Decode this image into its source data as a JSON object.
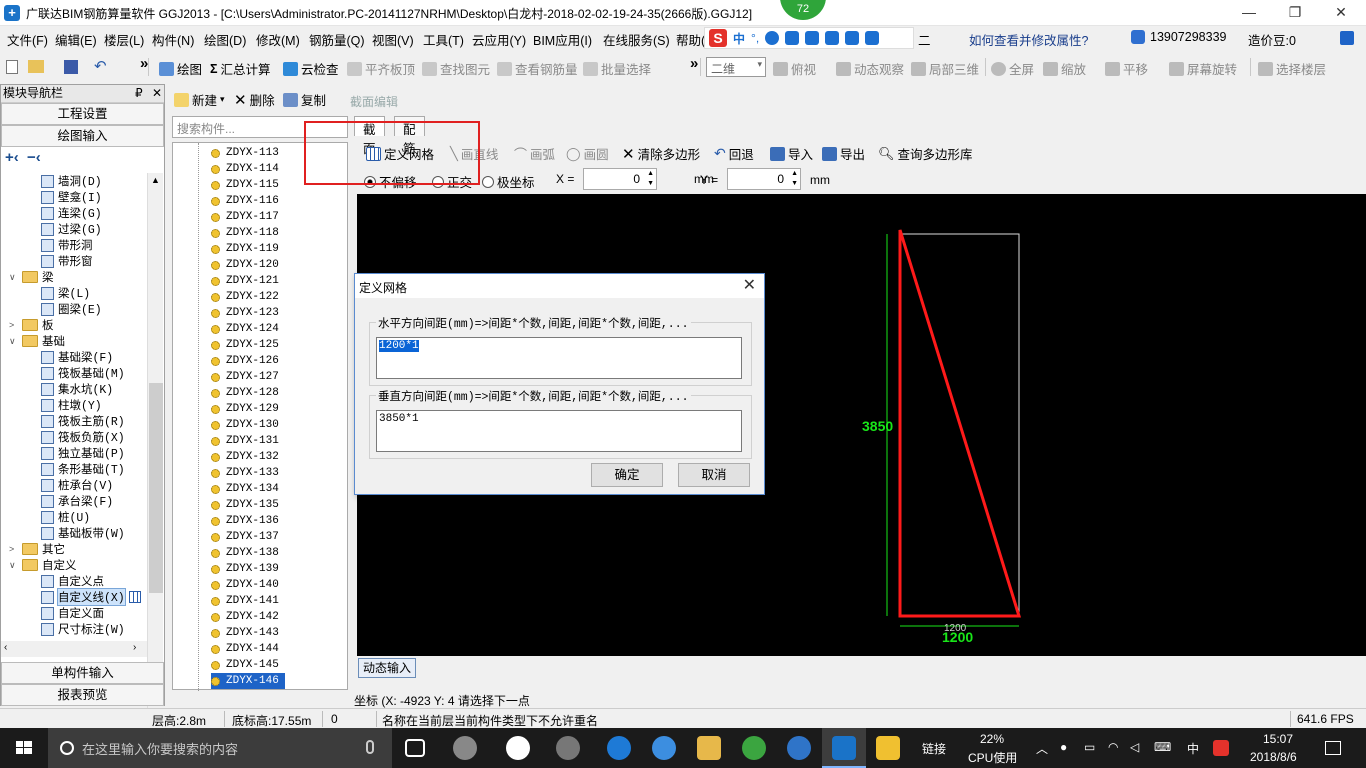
{
  "titlebar": {
    "title": "广联达BIM钢筋算量软件 GGJ2013 - [C:\\Users\\Administrator.PC-20141127NRHM\\Desktop\\白龙村-2018-02-02-19-24-35(2666版).GGJ12]",
    "update_badge": "72",
    "minimize": "—",
    "restore": "❐",
    "close": "✕"
  },
  "menu": {
    "items": [
      "文件(F)",
      "编辑(E)",
      "楼层(L)",
      "构件(N)",
      "绘图(D)",
      "修改(M)",
      "钢筋量(Q)",
      "视图(V)",
      "工具(T)",
      "云应用(Y)",
      "BIM应用(I)",
      "在线服务(S)",
      "帮助(H)"
    ],
    "ime_chars": [
      "中",
      "°,"
    ],
    "right_text": "二",
    "help_link": "如何查看并修改属性?",
    "phone": "13907298339",
    "beans": "造价豆:0"
  },
  "toolbar": {
    "items": [
      "绘图",
      "汇总计算",
      "云检查",
      "平齐板顶",
      "查找图元",
      "查看钢筋量",
      "批量选择"
    ],
    "view_mode": "二维",
    "view_items": [
      "俯视",
      "动态观察",
      "局部三维",
      "全屏",
      "缩放",
      "平移",
      "屏幕旋转",
      "选择楼层"
    ]
  },
  "nav": {
    "title": "模块导航栏",
    "pin": "₽",
    "close": "✕",
    "sections_top": [
      "工程设置",
      "绘图输入"
    ],
    "sections_bottom": [
      "单构件输入",
      "报表预览"
    ],
    "tree": [
      {
        "label": "墙洞(D)",
        "level": 2,
        "icon": "wall-hole-icon"
      },
      {
        "label": "壁龛(I)",
        "level": 2,
        "icon": "niche-icon"
      },
      {
        "label": "连梁(G)",
        "level": 2,
        "icon": "link-beam-icon"
      },
      {
        "label": "过梁(G)",
        "level": 2,
        "icon": "lintel-icon"
      },
      {
        "label": "带形洞",
        "level": 2,
        "icon": "strip-hole-icon"
      },
      {
        "label": "带形窗",
        "level": 2,
        "icon": "strip-window-icon"
      },
      {
        "label": "梁",
        "level": 1,
        "icon": "folder-icon",
        "exp": "∨"
      },
      {
        "label": "梁(L)",
        "level": 2,
        "icon": "beam-icon"
      },
      {
        "label": "圈梁(E)",
        "level": 2,
        "icon": "ring-beam-icon"
      },
      {
        "label": "板",
        "level": 1,
        "icon": "folder-icon",
        "exp": ">"
      },
      {
        "label": "基础",
        "level": 1,
        "icon": "folder-icon",
        "exp": "∨"
      },
      {
        "label": "基础梁(F)",
        "level": 2,
        "icon": "foundation-beam-icon"
      },
      {
        "label": "筏板基础(M)",
        "level": 2,
        "icon": "raft-foundation-icon"
      },
      {
        "label": "集水坑(K)",
        "level": 2,
        "icon": "sump-icon"
      },
      {
        "label": "柱墩(Y)",
        "level": 2,
        "icon": "column-pier-icon"
      },
      {
        "label": "筏板主筋(R)",
        "level": 2,
        "icon": "raft-main-rebar-icon"
      },
      {
        "label": "筏板负筋(X)",
        "level": 2,
        "icon": "raft-neg-rebar-icon"
      },
      {
        "label": "独立基础(P)",
        "level": 2,
        "icon": "isolated-foundation-icon"
      },
      {
        "label": "条形基础(T)",
        "level": 2,
        "icon": "strip-foundation-icon"
      },
      {
        "label": "桩承台(V)",
        "level": 2,
        "icon": "pile-cap-icon"
      },
      {
        "label": "承台梁(F)",
        "level": 2,
        "icon": "cap-beam-icon"
      },
      {
        "label": "桩(U)",
        "level": 2,
        "icon": "pile-icon"
      },
      {
        "label": "基础板带(W)",
        "level": 2,
        "icon": "foundation-strip-icon"
      },
      {
        "label": "其它",
        "level": 1,
        "icon": "folder-icon",
        "exp": ">"
      },
      {
        "label": "自定义",
        "level": 1,
        "icon": "folder-icon",
        "exp": "∨"
      },
      {
        "label": "自定义点",
        "level": 2,
        "icon": "custom-point-icon"
      },
      {
        "label": "自定义线(X)",
        "level": 2,
        "icon": "custom-line-icon",
        "selected": true
      },
      {
        "label": "自定义面",
        "level": 2,
        "icon": "custom-area-icon"
      },
      {
        "label": "尺寸标注(W)",
        "level": 2,
        "icon": "dimension-icon"
      }
    ]
  },
  "components": {
    "toolbar": [
      "新建",
      "删除",
      "复制"
    ],
    "search_placeholder": "搜索构件...",
    "items": [
      "ZDYX-113",
      "ZDYX-114",
      "ZDYX-115",
      "ZDYX-116",
      "ZDYX-117",
      "ZDYX-118",
      "ZDYX-119",
      "ZDYX-120",
      "ZDYX-121",
      "ZDYX-122",
      "ZDYX-123",
      "ZDYX-124",
      "ZDYX-125",
      "ZDYX-126",
      "ZDYX-127",
      "ZDYX-128",
      "ZDYX-129",
      "ZDYX-130",
      "ZDYX-131",
      "ZDYX-132",
      "ZDYX-133",
      "ZDYX-134",
      "ZDYX-135",
      "ZDYX-136",
      "ZDYX-137",
      "ZDYX-138",
      "ZDYX-139",
      "ZDYX-140",
      "ZDYX-141",
      "ZDYX-142",
      "ZDYX-143",
      "ZDYX-144",
      "ZDYX-145",
      "ZDYX-146"
    ],
    "selected": "ZDYX-146"
  },
  "editor": {
    "title": "截面编辑",
    "tabs": [
      "截面",
      "配筋"
    ],
    "toolbar": [
      "定义网格",
      "画直线",
      "画弧",
      "画圆",
      "清除多边形",
      "回退",
      "导入",
      "导出",
      "查询多边形库"
    ],
    "options": [
      "不偏移",
      "正交",
      "极坐标"
    ],
    "x_label": "X =",
    "x_value": "0",
    "y_label": "Y =",
    "y_value": "0",
    "unit": "mm",
    "dim_height": "3850",
    "dim_width": "1200",
    "dim_width_small": "1200",
    "dynamic_input": "动态输入",
    "coord_text": "坐标 (X: -4923 Y: 4",
    "prompt": "请选择下一点"
  },
  "dialog": {
    "title": "定义网格",
    "close": "✕",
    "horizontal_label": "水平方向间距(mm)=>间距*个数,间距,间距*个数,间距,...",
    "horizontal_value": "1200*1",
    "vertical_label": "垂直方向间距(mm)=>间距*个数,间距,间距*个数,间距,...",
    "vertical_value": "3850*1",
    "ok": "确定",
    "cancel": "取消"
  },
  "statusbar": {
    "floor_height": "层高:2.8m",
    "base_height": "底标高:17.55m",
    "zero": "0",
    "message": "名称在当前层当前构件类型下不允许重名",
    "fps": "641.6 FPS"
  },
  "taskbar": {
    "search_placeholder": "在这里输入你要搜索的内容",
    "link_label": "链接",
    "cpu_percent": "22%",
    "cpu_label": "CPU使用",
    "ime": "中",
    "time": "15:07",
    "date": "2018/8/6"
  },
  "colors": {
    "canvas_bg": "#000000",
    "polygon": "#ff1a1a",
    "dim_text": "#19e619",
    "annotation": "#e02020",
    "selection": "#1e63c7"
  }
}
